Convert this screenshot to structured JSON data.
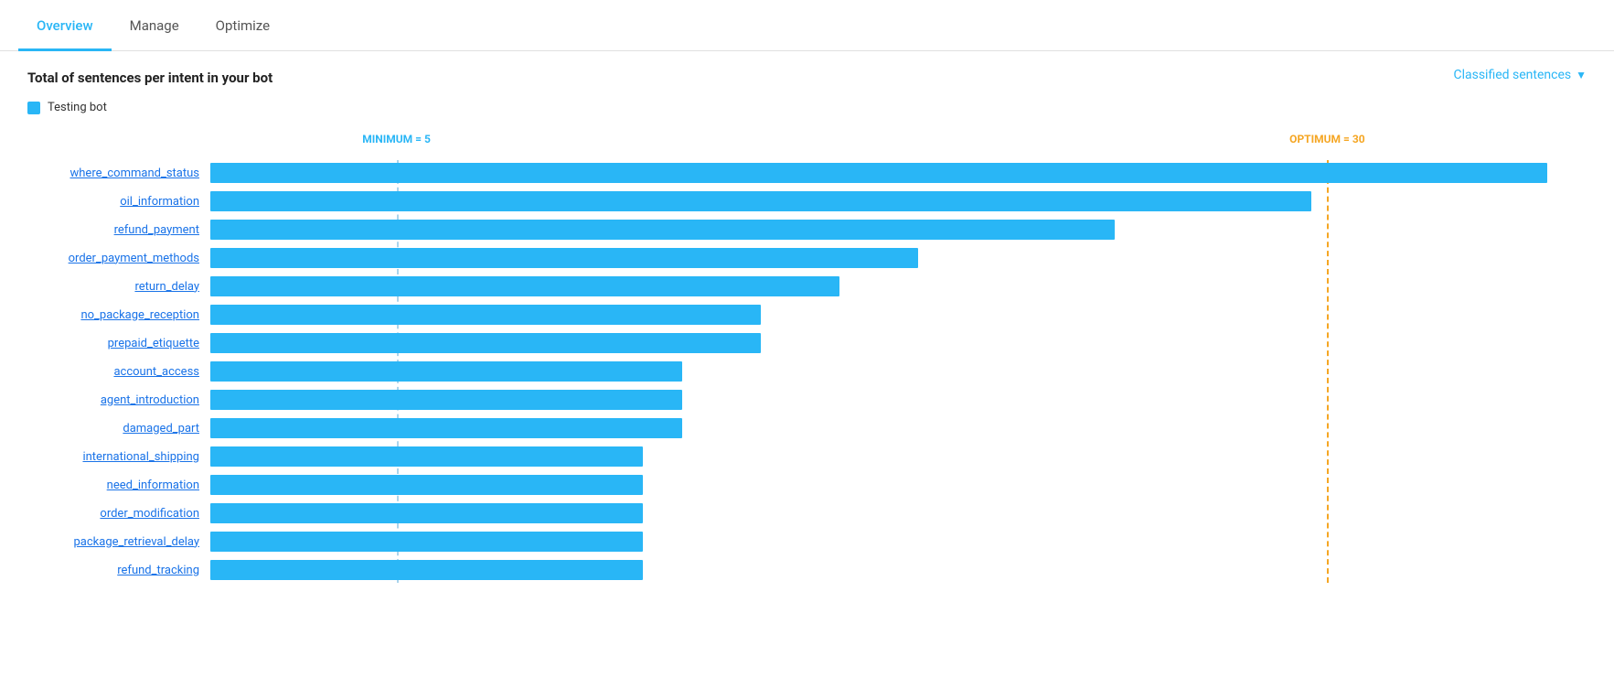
{
  "tabs": [
    {
      "label": "Overview",
      "active": true
    },
    {
      "label": "Manage",
      "active": false
    },
    {
      "label": "Optimize",
      "active": false
    }
  ],
  "section_title": "Total of sentences per intent in your bot",
  "legend": {
    "label": "Testing bot"
  },
  "classified_sentences_label": "Classified sentences",
  "minimum_label": "MINIMUM = 5",
  "optimum_label": "OPTIMUM = 30",
  "minimum_value": 5,
  "optimum_value": 30,
  "max_value": 35,
  "intents": [
    {
      "name": "where_command_status",
      "value": 34
    },
    {
      "name": "oil_information",
      "value": 28
    },
    {
      "name": "refund_payment",
      "value": 23
    },
    {
      "name": "order_payment_methods",
      "value": 18
    },
    {
      "name": "return_delay",
      "value": 16
    },
    {
      "name": "no_package_reception",
      "value": 14
    },
    {
      "name": "prepaid_etiquette",
      "value": 14
    },
    {
      "name": "account_access",
      "value": 12
    },
    {
      "name": "agent_introduction",
      "value": 12
    },
    {
      "name": "damaged_part",
      "value": 12
    },
    {
      "name": "international_shipping",
      "value": 11
    },
    {
      "name": "need_information",
      "value": 11
    },
    {
      "name": "order_modification",
      "value": 11
    },
    {
      "name": "package_retrieval_delay",
      "value": 11
    },
    {
      "name": "refund_tracking",
      "value": 11
    }
  ],
  "colors": {
    "bar": "#29b6f6",
    "minimum_line": "#29b6f6",
    "optimum_line": "#f5a623",
    "tab_active": "#29b6f6",
    "link": "#1a73e8"
  }
}
